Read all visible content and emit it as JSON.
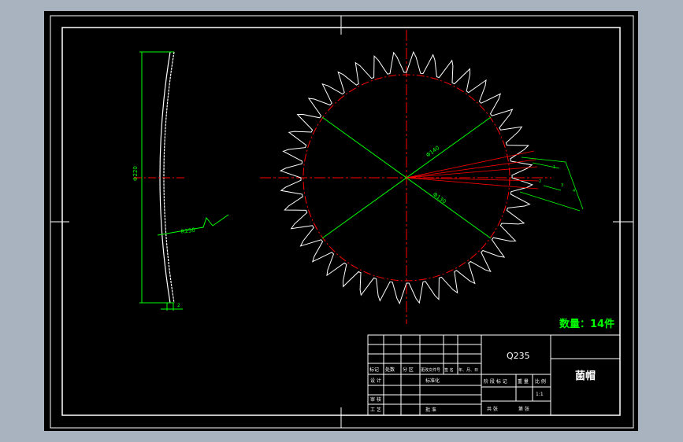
{
  "drawing": {
    "quantity_label": "数量：14件",
    "dim_sector_radius": "R250",
    "dim_sector_height": "Φ220",
    "dim_sector_thickness": "2",
    "dim_outer": "Φ140",
    "dim_root": "Φ130",
    "dim_tooth_a": "1",
    "dim_tooth_b": "2",
    "dim_tooth_c": "3",
    "dim_tooth_d": "4"
  },
  "title_block": {
    "material": "Q235",
    "part_name": "菌帽",
    "row_marks": [
      "标记",
      "处数",
      "分 区",
      "更改文件号",
      "签 名",
      "年、月、日"
    ],
    "design": "设 计",
    "standardize": "标准化",
    "review": "审 核",
    "process": "工 艺",
    "approve": "批 准",
    "stage_mark": "阶 段 标 记",
    "weight": "重 量",
    "scale": "比 例",
    "scale_value": "1:1",
    "sheet_total": "共   张",
    "sheet_no": "第   张"
  },
  "colors": {
    "background": "#000000",
    "frame": "#ffffff",
    "dimension": "#00ff00",
    "centerline": "#ff0000",
    "gear_outline": "#ffffff",
    "chrome": "#a9b2bf",
    "quantity": "#00ff00"
  }
}
